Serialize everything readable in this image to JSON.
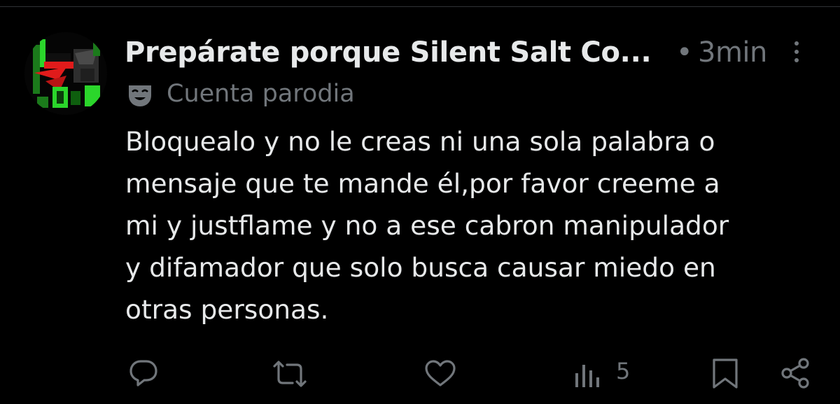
{
  "post": {
    "author_display_name": "Prepárate porque Silent Salt Co...",
    "separator": "•",
    "timestamp": "3min",
    "parody_label": "Cuenta parodia",
    "text": "Bloquealo y no le creas ni una sola palabra o\nmensaje que te mande él,por favor creeme a\nmi y justflame y no a ese cabron manipulador\ny difamador que solo busca causar miedo en\notras personas.",
    "views": "5"
  },
  "icons": {
    "more": "more-vertical-icon",
    "parody": "theater-mask-icon",
    "reply": "reply-bubble-icon",
    "repost": "repost-icon",
    "like": "heart-icon",
    "views": "views-bar-chart-icon",
    "bookmark": "bookmark-icon",
    "share": "share-icon"
  },
  "colors": {
    "background": "#000000",
    "primary_text": "#e7e9ea",
    "secondary_text": "#71767b",
    "avatar_accent": "#2bd62b",
    "avatar_red": "#e01b1b"
  }
}
